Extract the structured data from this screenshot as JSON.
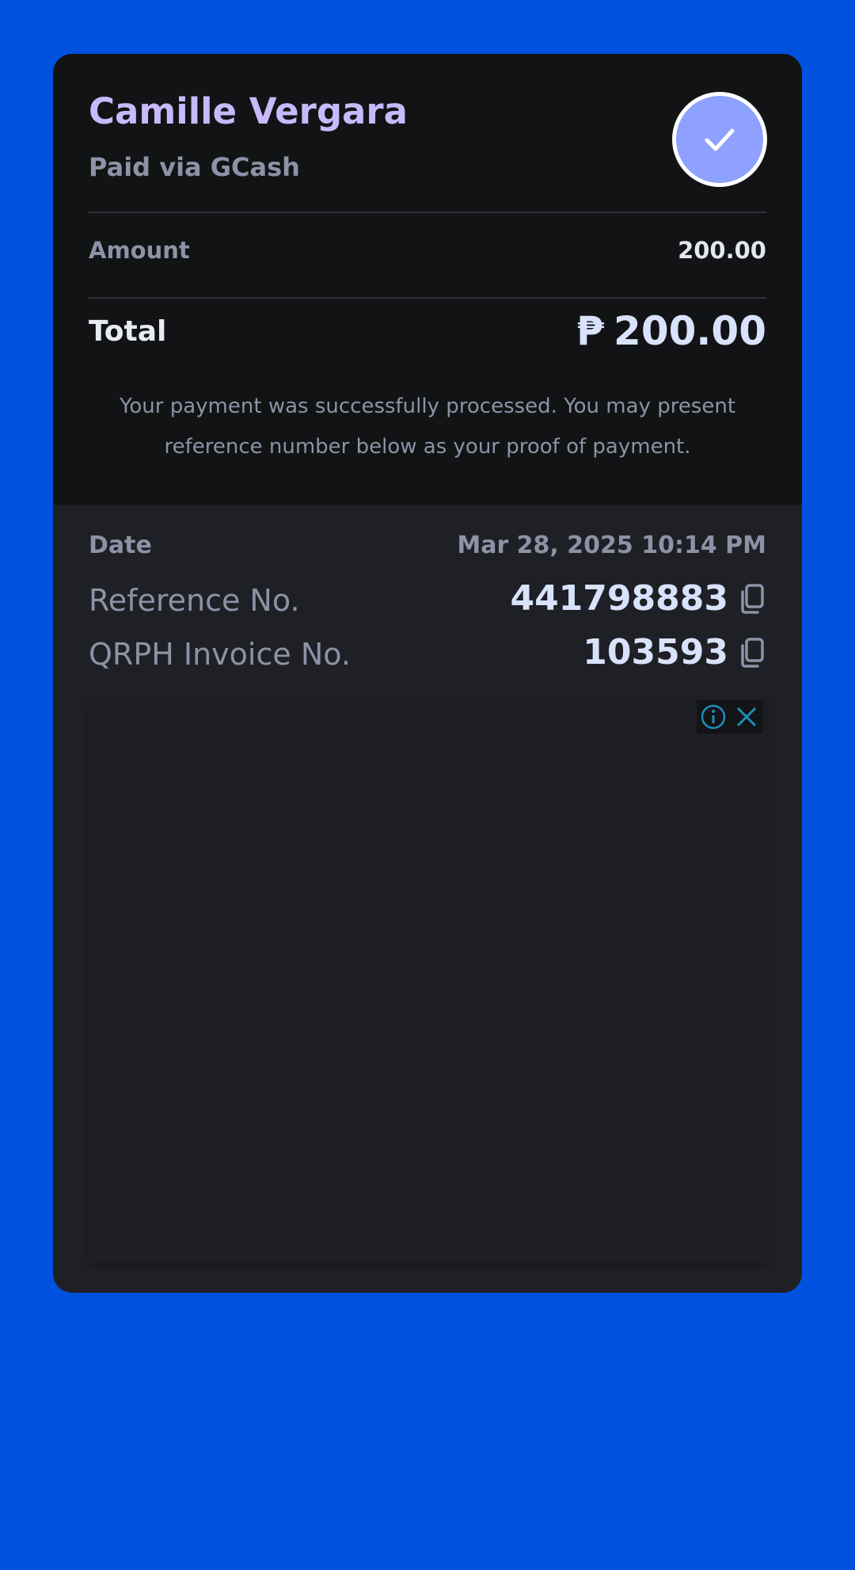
{
  "payer": {
    "name": "Camille Vergara",
    "method": "Paid via GCash"
  },
  "amount": {
    "label": "Amount",
    "value": "200.00"
  },
  "total": {
    "label": "Total",
    "currency": "₱",
    "value": "200.00"
  },
  "message": "Your payment was successfully processed. You may present reference number below as your proof of payment.",
  "details": {
    "date_label": "Date",
    "date_value": "Mar 28, 2025 10:14 PM",
    "reference_label": "Reference No.",
    "reference_value": "441798883",
    "invoice_label": "QRPH Invoice No.",
    "invoice_value": "103593"
  },
  "icons": {
    "status": "check-icon",
    "copy": "copy-icon",
    "ad_info": "info-icon",
    "ad_close": "close-icon"
  },
  "colors": {
    "background": "#0052de",
    "card_top": "#121315",
    "card_bottom": "#1f2025",
    "name": "#c7b9fb",
    "check_badge": "#8ea1ff",
    "muted_text": "#8c93a6",
    "value_text": "#d9e2fb",
    "ad_icon": "#1d8fb8"
  }
}
